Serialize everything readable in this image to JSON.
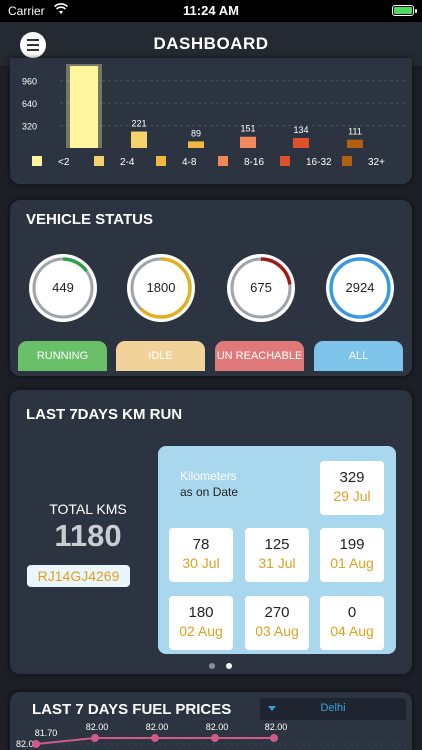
{
  "status_bar": {
    "carrier": "Carrier",
    "time": "11:24 AM"
  },
  "nav": {
    "title": "DASHBOARD"
  },
  "histogram": {
    "y_ticks": [
      "960",
      "640",
      "320"
    ],
    "bars": [
      {
        "label": "<2",
        "value": 1100,
        "value_label": "",
        "color": "#fff59d"
      },
      {
        "label": "2-4",
        "value": 221,
        "value_label": "221",
        "color": "#f5d26a"
      },
      {
        "label": "4-8",
        "value": 89,
        "value_label": "89",
        "color": "#f0b840"
      },
      {
        "label": "8-16",
        "value": 151,
        "value_label": "151",
        "color": "#f08858"
      },
      {
        "label": "16-32",
        "value": 134,
        "value_label": "134",
        "color": "#e0502a"
      },
      {
        "label": "32+",
        "value": 111,
        "value_label": "111",
        "color": "#b06010"
      }
    ]
  },
  "vehicle_status": {
    "title": "VEHICLE STATUS",
    "items": [
      {
        "value": "449",
        "label": "RUNNING",
        "fraction": 0.15,
        "color": "#2e9e4a",
        "button_color": "#6abf69"
      },
      {
        "value": "1800",
        "label": "IDLE",
        "fraction": 0.62,
        "color": "#e0b020",
        "button_color": "#f1d39a"
      },
      {
        "value": "675",
        "label": "UN REACHABLE",
        "fraction": 0.23,
        "color": "#a01818",
        "button_color": "#e07a7a"
      },
      {
        "value": "2924",
        "label": "ALL",
        "fraction": 1.0,
        "color": "#3a9ae0",
        "button_color": "#7ec3ea"
      }
    ]
  },
  "km_run": {
    "title": "LAST 7DAYS KM RUN",
    "total_label": "TOTAL KMS",
    "total_value": "1180",
    "vehicle": "RJ14GJ4269",
    "panel_label": "Kilometers",
    "panel_sub": "as on Date",
    "days": [
      {
        "km": "329",
        "date": "29 Jul"
      },
      {
        "km": "78",
        "date": "30 Jul"
      },
      {
        "km": "125",
        "date": "31 Jul"
      },
      {
        "km": "199",
        "date": "01 Aug"
      },
      {
        "km": "180",
        "date": "02 Aug"
      },
      {
        "km": "270",
        "date": "03 Aug"
      },
      {
        "km": "0",
        "date": "04 Aug"
      }
    ]
  },
  "fuel": {
    "title": "LAST 7 DAYS FUEL PRICES",
    "city": "Delhi",
    "y_tick": "82.0",
    "points": [
      {
        "value": 81.7,
        "label": "81.70"
      },
      {
        "value": 82.0,
        "label": "82.00"
      },
      {
        "value": 82.0,
        "label": "82.00"
      },
      {
        "value": 82.0,
        "label": "82.00"
      },
      {
        "value": 82.0,
        "label": "82.00"
      }
    ]
  }
}
